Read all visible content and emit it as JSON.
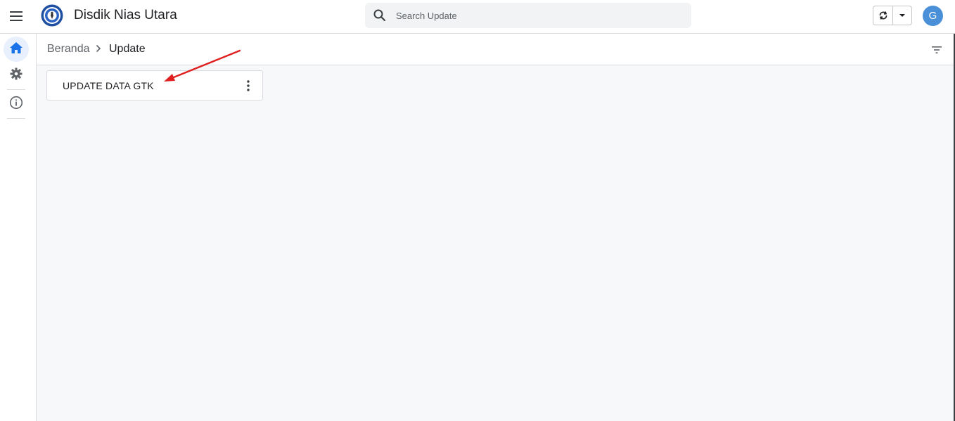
{
  "header": {
    "app_title": "Disdik Nias Utara",
    "search_placeholder": "Search Update",
    "avatar_initial": "G",
    "icons": [
      "menu-icon",
      "logo",
      "search-icon",
      "sync-icon",
      "dropdown-caret-icon"
    ]
  },
  "rail": {
    "items": [
      {
        "name": "home",
        "icon": "home-icon",
        "active": true
      },
      {
        "name": "settings",
        "icon": "gear-icon",
        "active": false
      },
      {
        "name": "info",
        "icon": "info-icon",
        "active": false
      }
    ]
  },
  "breadcrumb": {
    "home": "Beranda",
    "current": "Update"
  },
  "cards": [
    {
      "label": "UPDATE DATA GTK"
    }
  ],
  "colors": {
    "accent": "#1a73e8",
    "avatar": "#4a90d9",
    "annotation_arrow": "#e02020",
    "content_bg": "#f7f8fa"
  }
}
